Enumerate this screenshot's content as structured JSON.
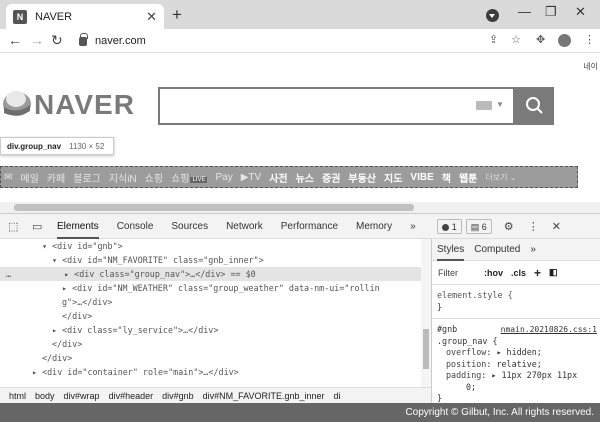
{
  "browser": {
    "tab_title": "NAVER",
    "favicon_letter": "N",
    "url": "naver.com"
  },
  "page": {
    "lang_link": "네이",
    "logo": "NAVER",
    "tooltip_selector": "div.group_nav",
    "tooltip_size": "1130 × 52",
    "nav_items": [
      "메일",
      "카페",
      "블로그",
      "지식iN",
      "쇼핑",
      "쇼핑",
      "Pay",
      "▶TV",
      "사전",
      "뉴스",
      "증권",
      "부동산",
      "지도",
      "VIBE",
      "책",
      "웹툰"
    ],
    "live_badge": "LIVE",
    "more_label": "더보기"
  },
  "devtools": {
    "tabs": [
      "Elements",
      "Console",
      "Sources",
      "Network",
      "Performance",
      "Memory"
    ],
    "more_tabs": "»",
    "errors": "1",
    "messages": "6",
    "lines": [
      "▾ <div id=\"gnb\">",
      "▾ <div id=\"NM_FAVORITE\" class=\"gnb_inner\">",
      "▸ <div class=\"group_nav\">…</div> == $0",
      "▸ <div id=\"NM_WEATHER\" class=\"group_weather\" data-nm-ui=\"rollin",
      "g\">…</div>",
      "</div>",
      "▸ <div class=\"ly_service\">…</div>",
      "</div>",
      "</div>",
      "▸ <div id=\"container\" role=\"main\">…</div>"
    ],
    "breadcrumbs": [
      "html",
      "body",
      "div#wrap",
      "div#header",
      "div#gnb",
      "div#NM_FAVORITE.gnb_inner",
      "di"
    ],
    "styles": {
      "tabs": [
        "Styles",
        "Computed"
      ],
      "more": "»",
      "filter_placeholder": "Filter",
      "hov": ":hov",
      "cls": ".cls",
      "element_style": "element.style {",
      "close_brace": "}",
      "rule_selector1": "#gnb",
      "rule_source": "nmain.20210826.css:1",
      "rule_selector2": ".group_nav {",
      "props": [
        {
          "name": "overflow",
          "value": "▸ hidden;"
        },
        {
          "name": "position",
          "value": "relative;"
        },
        {
          "name": "padding",
          "value": "▸ 11px 270px 11px"
        },
        {
          "name": "",
          "value": "0;"
        }
      ]
    }
  },
  "copyright": "Copyright © Gilbut, Inc. All rights reserved."
}
